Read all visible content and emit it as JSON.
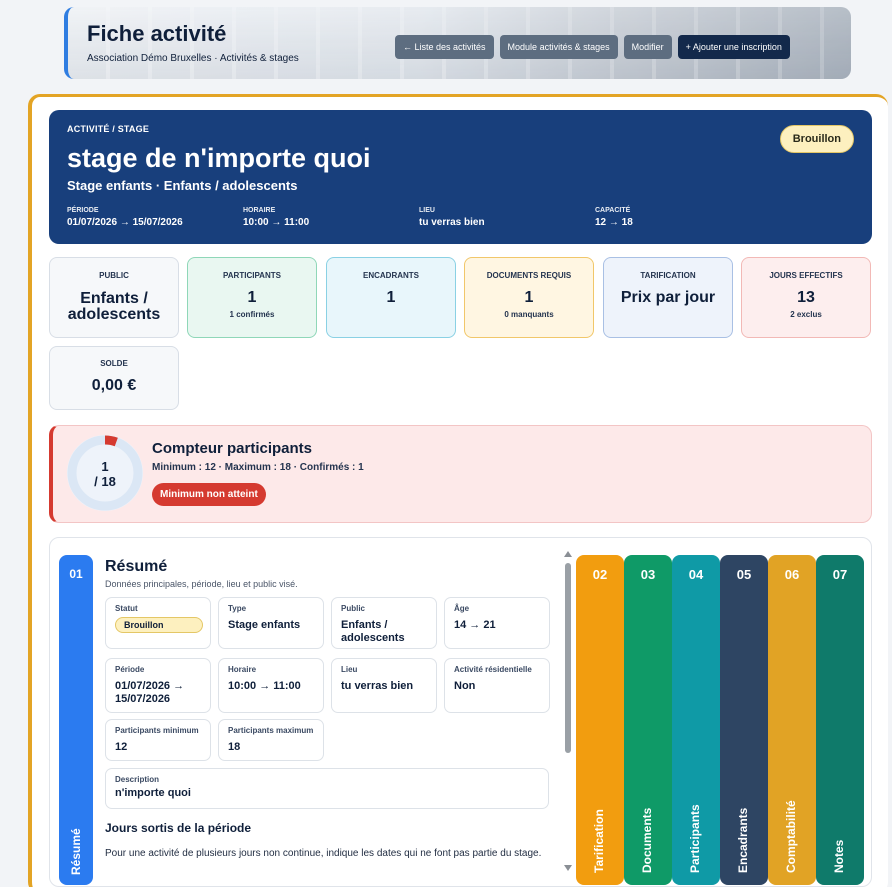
{
  "header": {
    "title": "Fiche activité",
    "subtitle": "Association Démo Bruxelles · Activités & stages",
    "buttons": {
      "back": "← Liste des activités",
      "module": "Module activités & stages",
      "edit": "Modifier",
      "add": "+ Ajouter une inscription"
    }
  },
  "hero": {
    "kicker": "ACTIVITÉ / STAGE",
    "name": "stage de n'importe quoi",
    "meta": "Stage enfants · Enfants / adolescents",
    "status_badge": "Brouillon",
    "facts": [
      {
        "label": "PÉRIODE",
        "value": "01/07/2026 → 15/07/2026"
      },
      {
        "label": "HORAIRE",
        "value": "10:00 → 11:00"
      },
      {
        "label": "LIEU",
        "value": "tu verras bien"
      },
      {
        "label": "CAPACITÉ",
        "value": "12 → 18"
      }
    ]
  },
  "stats": [
    {
      "label": "PUBLIC",
      "value": "Enfants / adolescents",
      "sub": ""
    },
    {
      "label": "PARTICIPANTS",
      "value": "1",
      "sub": "1 confirmés"
    },
    {
      "label": "ENCADRANTS",
      "value": "1",
      "sub": ""
    },
    {
      "label": "DOCUMENTS REQUIS",
      "value": "1",
      "sub": "0 manquants"
    },
    {
      "label": "TARIFICATION",
      "value": "Prix par jour",
      "sub": ""
    },
    {
      "label": "JOURS EFFECTIFS",
      "value": "13",
      "sub": "2 exclus"
    },
    {
      "label": "SOLDE",
      "value": "0,00 €",
      "sub": ""
    }
  ],
  "counter": {
    "title": "Compteur participants",
    "line": "Minimum : 12 · Maximum : 18 · Confirmés : 1",
    "donut_value": "1",
    "donut_total": "/ 18",
    "fill_fraction": 0.0556,
    "warning": "Minimum non atteint",
    "colors": {
      "fill": "#d53a30",
      "track": "#dbe7f5"
    }
  },
  "section": {
    "tab_num": "01",
    "tab_label": "Résumé",
    "title": "Résumé",
    "description": "Données principales, période, lieu et public visé.",
    "fields": {
      "statut": {
        "label": "Statut",
        "value": "Brouillon"
      },
      "type": {
        "label": "Type",
        "value": "Stage enfants"
      },
      "public": {
        "label": "Public",
        "value": "Enfants / adolescents"
      },
      "age": {
        "label": "Âge",
        "value": "14 → 21"
      },
      "periode": {
        "label": "Période",
        "value": "01/07/2026 → 15/07/2026"
      },
      "horaire": {
        "label": "Horaire",
        "value": "10:00 → 11:00"
      },
      "lieu": {
        "label": "Lieu",
        "value": "tu verras bien"
      },
      "residentielle": {
        "label": "Activité résidentielle",
        "value": "Non"
      },
      "min": {
        "label": "Participants minimum",
        "value": "12"
      },
      "max": {
        "label": "Participants maximum",
        "value": "18"
      },
      "description": {
        "label": "Description",
        "value": "n'importe quoi"
      }
    },
    "subheading": "Jours sortis de la période",
    "paragraph": "Pour une activité de plusieurs jours non continue, indique les dates qui ne font pas partie du stage."
  },
  "side_tabs": [
    {
      "num": "02",
      "label": "Tarification",
      "color": "#f29d0f"
    },
    {
      "num": "03",
      "label": "Documents",
      "color": "#0f9a67"
    },
    {
      "num": "04",
      "label": "Participants",
      "color": "#0f9aa6"
    },
    {
      "num": "05",
      "label": "Encadrants",
      "color": "#2e4563"
    },
    {
      "num": "06",
      "label": "Comptabilité",
      "color": "#e1a325"
    },
    {
      "num": "07",
      "label": "Notes",
      "color": "#0f7a6a"
    }
  ]
}
